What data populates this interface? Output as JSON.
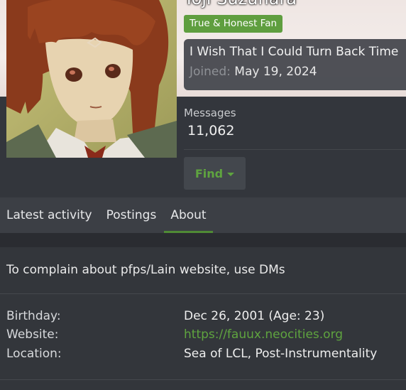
{
  "profile": {
    "username": "Toji Suzuhara",
    "user_title": "True & Honest Fan",
    "status": "I Wish That I Could Turn Back Time",
    "joined_label": "Joined:",
    "joined_value": "May 19, 2024",
    "messages_label": "Messages",
    "messages_value": "11,062",
    "find_label": "Find"
  },
  "tabs": [
    {
      "label": "Latest activity",
      "active": false
    },
    {
      "label": "Postings",
      "active": false
    },
    {
      "label": "About",
      "active": true
    }
  ],
  "about": {
    "text": "To complain about pfps/Lain website, use DMs",
    "rows": [
      {
        "label": "Birthday:",
        "value": "Dec 26, 2001 (Age: 23)"
      },
      {
        "label": "Website:",
        "value": "https://fauux.neocities.org"
      },
      {
        "label": "Location:",
        "value": "Sea of LCL, Post-Instrumentality"
      }
    ]
  },
  "colors": {
    "accent_green": "#5fa43f",
    "badge_green": "#5f9e3f",
    "background": "#2e3136"
  }
}
